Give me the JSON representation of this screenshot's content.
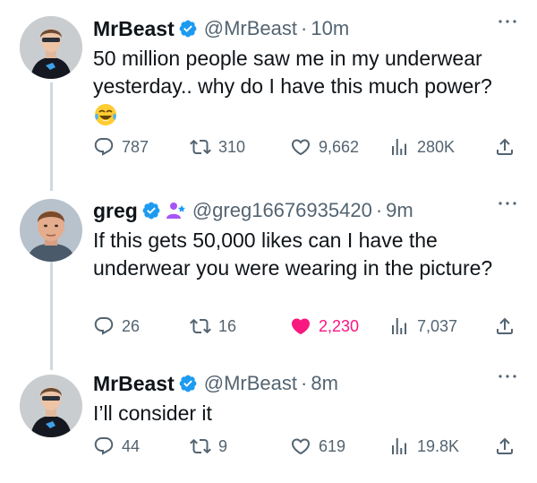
{
  "tweets": [
    {
      "name": "MrBeast",
      "handle": "@MrBeast",
      "dot": "·",
      "time": "10m",
      "text": "50 million people saw me in my underwear yesterday.. why do I have this much power?",
      "emoji": "face-with-tears-of-joy",
      "replies": "787",
      "retweets": "310",
      "likes": "9,662",
      "views": "280K",
      "liked": false
    },
    {
      "name": "greg",
      "handle": "@greg16676935420",
      "dot": "·",
      "time": "9m",
      "text": "If this gets 50,000 likes can I have the underwear you were wearing in the picture?",
      "replies": "26",
      "retweets": "16",
      "likes": "2,230",
      "views": "7,037",
      "liked": true
    },
    {
      "name": "MrBeast",
      "handle": "@MrBeast",
      "dot": "·",
      "time": "8m",
      "text": "I’ll consider it",
      "replies": "44",
      "retweets": "9",
      "likes": "619",
      "views": "19.8K",
      "liked": false
    }
  ],
  "colors": {
    "verified": "#1d9bf0",
    "affiliate": "#a855f7",
    "muted": "#536471",
    "like_active": "#f91880",
    "thread_line": "#cfd9de"
  },
  "icons": [
    "more-icon",
    "reply-icon",
    "retweet-icon",
    "like-icon",
    "views-icon",
    "share-icon",
    "verified-badge-icon",
    "affiliate-badge-icon"
  ]
}
